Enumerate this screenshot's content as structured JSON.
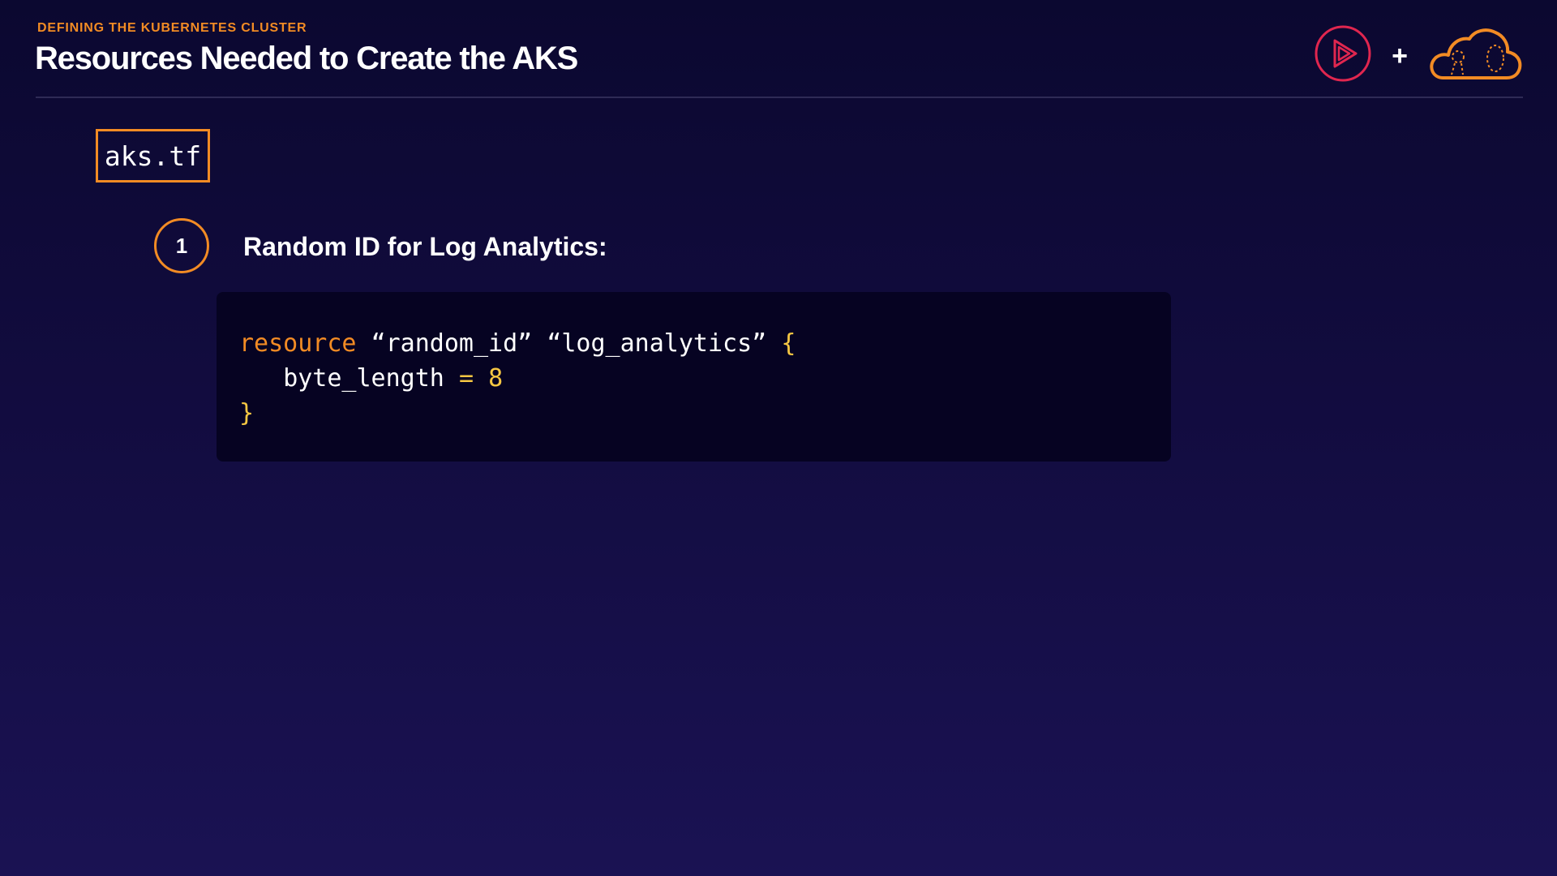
{
  "header": {
    "eyebrow": "DEFINING THE KUBERNETES CLUSTER",
    "title": "Resources Needed to Create the AKS",
    "plus": "+",
    "logos": [
      "pluralsight-play-icon",
      "cloud-icon"
    ]
  },
  "file": {
    "name": "aks.tf"
  },
  "step": {
    "number": "1",
    "title": "Random ID for Log Analytics:"
  },
  "code": {
    "keyword": "resource",
    "arg1": "“random_id”",
    "arg2": "“log_analytics”",
    "open_brace": "{",
    "attr_name": "byte_length",
    "equals": "=",
    "attr_value": "8",
    "close_brace": "}"
  },
  "colors": {
    "accent": "#f28b24",
    "play_red": "#e0264f",
    "code_yellow": "#f6c743",
    "background": "#120c3f",
    "code_background": "#060322"
  }
}
